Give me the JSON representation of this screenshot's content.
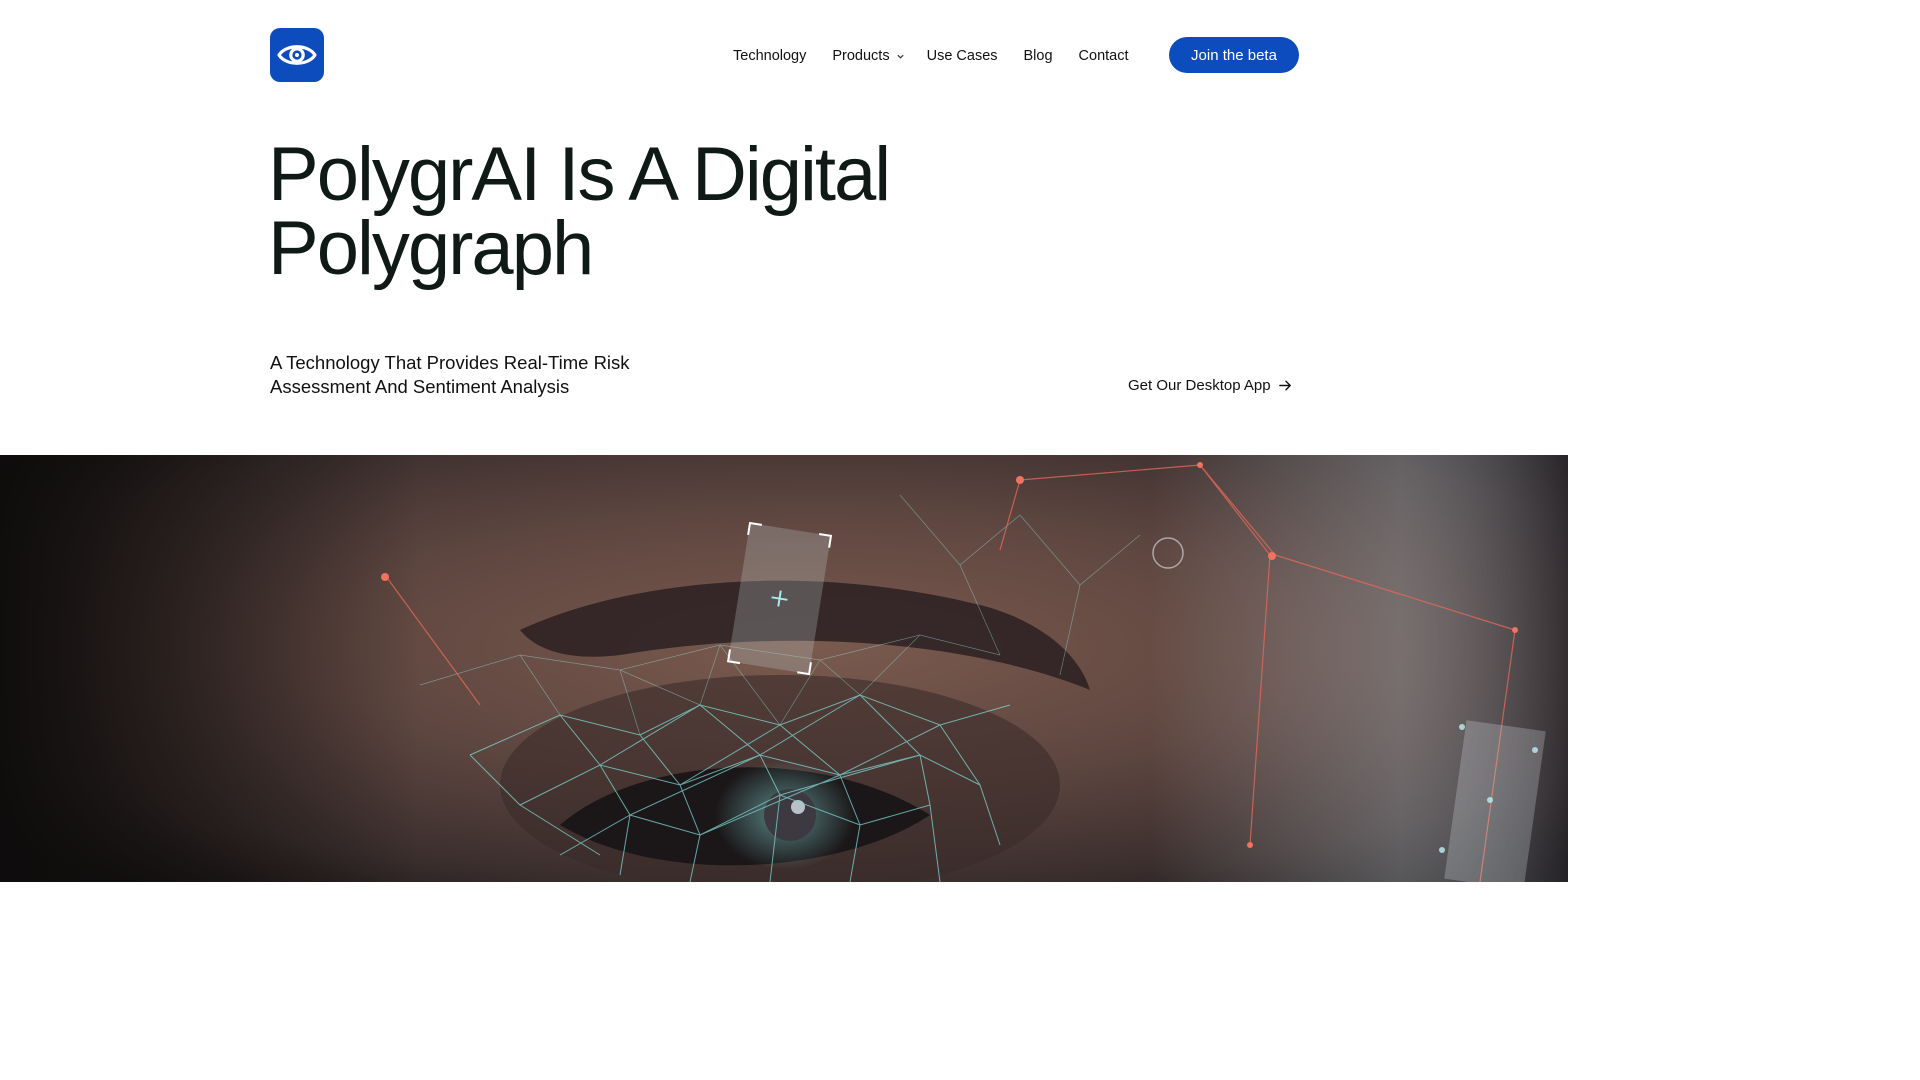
{
  "brand": {
    "logo_icon": "eye-icon",
    "accent_color": "#0c4cbc"
  },
  "nav": {
    "items": [
      {
        "label": "Technology"
      },
      {
        "label": "Products"
      },
      {
        "label": "Use Cases"
      },
      {
        "label": "Blog"
      },
      {
        "label": "Contact"
      }
    ],
    "cta_label": "Join the beta"
  },
  "hero": {
    "title_line1": "PolygrAI Is A Digital",
    "title_line2": "Polygraph",
    "subtitle_line1": "A Technology That Provides Real-Time Risk",
    "subtitle_line2": "Assessment And Sentiment Analysis",
    "desktop_link_label": "Get Our Desktop App",
    "desktop_link_icon": "arrow-right-icon"
  },
  "hero_image": {
    "subject": "close-up-eye-face-mesh-photo"
  }
}
